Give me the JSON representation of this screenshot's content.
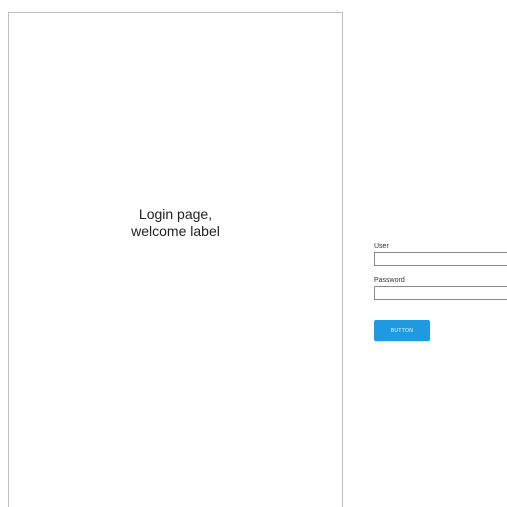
{
  "welcome": {
    "line1": "Login page,",
    "line2": "welcome label"
  },
  "form": {
    "user_label": "User",
    "user_value": "",
    "password_label": "Password",
    "password_value": "",
    "button_label": "BUTTON"
  },
  "colors": {
    "button_background": "#1e9be0",
    "button_text": "#ffffff",
    "panel_border": "#bfbfbf"
  }
}
